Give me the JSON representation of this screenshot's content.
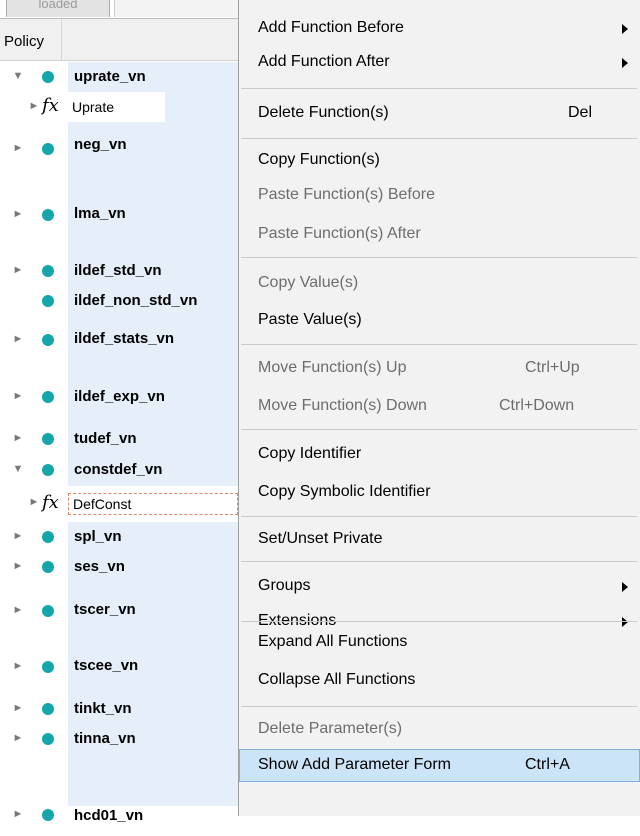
{
  "tab": {
    "label": "loaded"
  },
  "tree": {
    "column_header": "Policy",
    "items": [
      {
        "name": "uprate_vn",
        "expanded": true,
        "child": "Uprate"
      },
      {
        "name": "neg_vn"
      },
      {
        "name": "lma_vn"
      },
      {
        "name": "ildef_std_vn"
      },
      {
        "name": "ildef_non_std_vn"
      },
      {
        "name": "ildef_stats_vn"
      },
      {
        "name": "ildef_exp_vn"
      },
      {
        "name": "tudef_vn"
      },
      {
        "name": "constdef_vn",
        "expanded": true,
        "child": "DefConst"
      },
      {
        "name": "spl_vn"
      },
      {
        "name": "ses_vn"
      },
      {
        "name": "tscer_vn"
      },
      {
        "name": "tscee_vn"
      },
      {
        "name": "tinkt_vn"
      },
      {
        "name": "tinna_vn"
      },
      {
        "name": "hcd01_vn"
      }
    ]
  },
  "context_menu": {
    "items": [
      {
        "label": "Add Function Before",
        "submenu": true
      },
      {
        "label": "Add Function After",
        "submenu": true
      },
      {
        "label": "Delete Function(s)",
        "shortcut": "Del"
      },
      {
        "label": "Copy Function(s)"
      },
      {
        "label": "Paste Function(s) Before",
        "disabled": true
      },
      {
        "label": "Paste Function(s) After",
        "disabled": true
      },
      {
        "label": "Copy Value(s)",
        "disabled": true
      },
      {
        "label": "Paste Value(s)"
      },
      {
        "label": "Move Function(s) Up",
        "shortcut": "Ctrl+Up",
        "disabled": true
      },
      {
        "label": "Move Function(s) Down",
        "shortcut": "Ctrl+Down",
        "disabled": true
      },
      {
        "label": "Copy Identifier"
      },
      {
        "label": "Copy Symbolic Identifier"
      },
      {
        "label": "Set/Unset Private"
      },
      {
        "label": "Groups",
        "submenu": true
      },
      {
        "label": "Extensions",
        "submenu": true
      },
      {
        "label": "Expand All Functions"
      },
      {
        "label": "Collapse All Functions"
      },
      {
        "label": "Delete Parameter(s)",
        "disabled": true
      },
      {
        "label": "Show Add Parameter Form",
        "shortcut": "Ctrl+A",
        "hovered": true
      }
    ]
  },
  "colors": {
    "node_dot": "#15a6a9",
    "row_highlight": "#e6eef9",
    "menu_hover": "#cce4f7"
  },
  "icons": {
    "expand": "chevron-right-icon",
    "collapse": "chevron-down-icon",
    "function": "fx-icon"
  }
}
